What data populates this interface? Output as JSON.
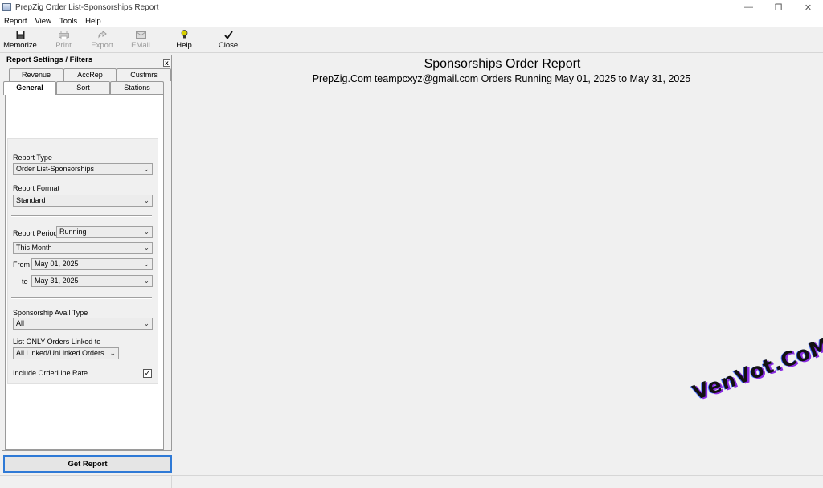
{
  "window": {
    "title": "PrepZig Order List-Sponsorships Report"
  },
  "menu": [
    "Report",
    "View",
    "Tools",
    "Help"
  ],
  "toolbar": {
    "memorize": "Memorize",
    "print": "Print",
    "export": "Export",
    "email": "EMail",
    "help": "Help",
    "close": "Close"
  },
  "panel": {
    "header": "Report Settings / Filters",
    "close_glyph": "x",
    "tabs_back": [
      "Revenue",
      "AccRep",
      "Custmrs"
    ],
    "tabs_front": [
      "General",
      "Sort",
      "Stations"
    ],
    "active_tab": "General"
  },
  "filters": {
    "report_type_label": "Report Type",
    "report_type_value": "Order List-Sponsorships",
    "report_format_label": "Report Format",
    "report_format_value": "Standard",
    "report_period_label": "Report Period",
    "report_period_value": "Running",
    "period_preset_value": "This Month",
    "from_label": "From",
    "from_value": "May 01, 2025",
    "to_label": "to",
    "to_value": "May 31, 2025",
    "avail_type_label": "Sponsorship Avail Type",
    "avail_type_value": "All",
    "linked_label": "List ONLY Orders Linked to",
    "linked_value": "All Linked/UnLinked Orders",
    "include_rate_label": "Include OrderLine Rate",
    "include_rate_checked": "✓"
  },
  "actions": {
    "get_report": "Get Report"
  },
  "report": {
    "title": "Sponsorships Order Report",
    "subtitle": "PrepZig.Com  teampcxyz@gmail.com  Orders Running May 01, 2025 to May 31, 2025"
  },
  "watermark": "VenVot.CoM"
}
